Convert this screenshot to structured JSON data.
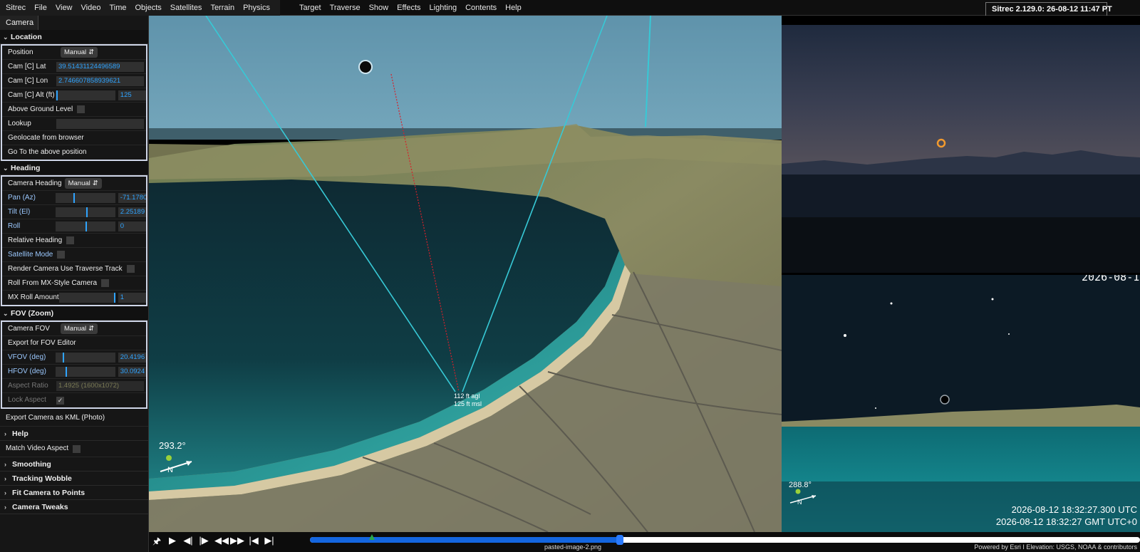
{
  "menubar": {
    "left_items": [
      "Sitrec",
      "File",
      "View",
      "Video",
      "Time",
      "Objects",
      "Satellites",
      "Terrain",
      "Physics"
    ],
    "mid_items": [
      "Target",
      "Traverse",
      "Show",
      "Effects",
      "Lighting",
      "Contents",
      "Help"
    ],
    "version": "Sitrec 2.129.0: 26-08-12 11:47 PT"
  },
  "sidebar": {
    "tab": "Camera",
    "location": {
      "title": "Location",
      "position_label": "Position",
      "position_value": "Manual",
      "lat_label": "Cam [C] Lat",
      "lat_value": "39.51431124496589",
      "lon_label": "Cam [C] Lon",
      "lon_value": "2.746607858939621",
      "alt_label": "Cam [C] Alt (ft)",
      "alt_value": "125",
      "alt_slider": 0.02,
      "agl_label": "Above Ground Level",
      "lookup_label": "Lookup",
      "geolocate_label": "Geolocate from browser",
      "goto_label": "Go To the above position"
    },
    "heading": {
      "title": "Heading",
      "cam_heading_label": "Camera Heading",
      "cam_heading_value": "Manual",
      "pan_label": "Pan (Az)",
      "pan_value": "-71.1780",
      "pan_slider": 0.3,
      "tilt_label": "Tilt (El)",
      "tilt_value": "2.25189",
      "tilt_slider": 0.51,
      "roll_label": "Roll",
      "roll_value": "0",
      "roll_slider": 0.5,
      "relative_label": "Relative Heading",
      "satmode_label": "Satellite Mode",
      "render_label": "Render Camera Use Traverse Track",
      "rollmx_label": "Roll From MX-Style Camera",
      "mxroll_label": "MX Roll Amount",
      "mxroll_value": "1",
      "mxroll_slider": 1.0
    },
    "fov": {
      "title": "FOV (Zoom)",
      "camfov_label": "Camera FOV",
      "camfov_value": "Manual",
      "export_label": "Export for FOV Editor",
      "vfov_label": "VFOV (deg)",
      "vfov_value": "20.4196",
      "vfov_slider": 0.12,
      "hfov_label": "HFOV (deg)",
      "hfov_value": "30.0924",
      "hfov_slider": 0.17,
      "aspect_label": "Aspect Ratio",
      "aspect_value": "1.4925  (1600x1072)",
      "lock_label": "Lock Aspect",
      "lock_check": "✓"
    },
    "export_kml": "Export Camera as KML (Photo)",
    "help": "Help",
    "match_video": "Match Video Aspect",
    "smoothing": "Smoothing",
    "tracking": "Tracking Wobble",
    "fit": "Fit Camera to Points",
    "tweaks": "Camera Tweaks"
  },
  "main_view": {
    "agl_text": "112 ft agl",
    "msl_text": "125 ft msl",
    "heading_text": "293.2°",
    "north": "N"
  },
  "right_bottom": {
    "date_partial": "2026-08-1",
    "heading_text": "288.8°",
    "north": "N",
    "utc": "2026-08-12 18:32:27.300 UTC",
    "gmt": "2026-08-12 18:32:27 GMT UTC+0"
  },
  "bottom": {
    "filename": "pasted-image-2.png",
    "credits": "Powered by Esri I Elevation: USGS, NOAA & contributors",
    "progress": 0.373,
    "marker": 0.075
  },
  "colors": {
    "accent": "#2fa4ff",
    "cyan_line": "#37c9d6",
    "red_line": "#d8202a"
  }
}
